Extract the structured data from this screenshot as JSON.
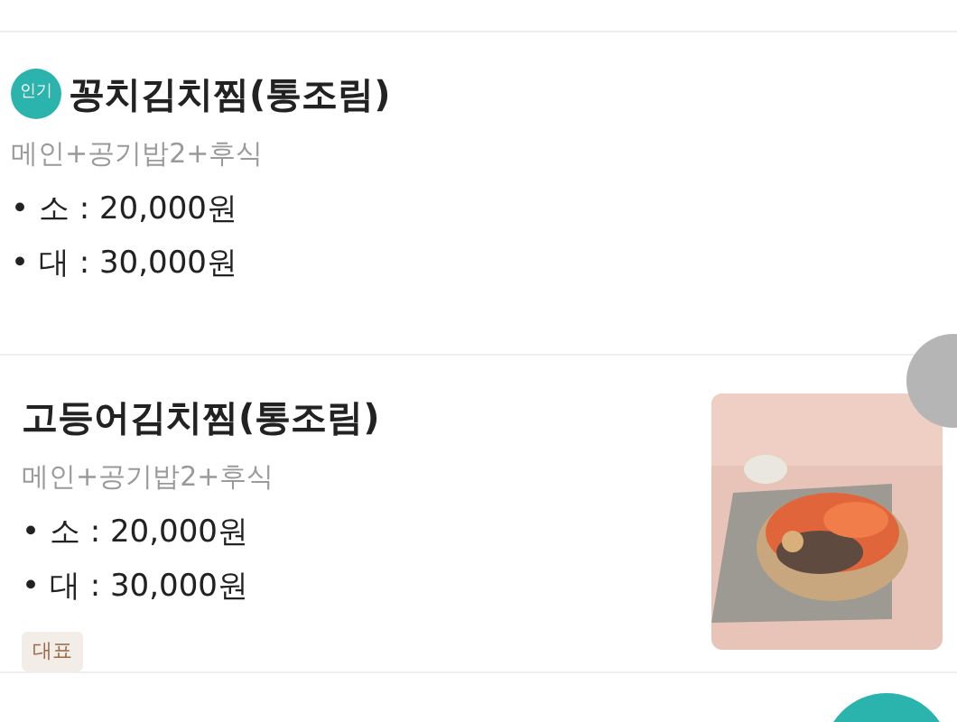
{
  "menu_items": [
    {
      "name": "꽁치김치찜(통조림)",
      "badge": "인기",
      "description": "메인+공기밥2+후식",
      "prices": [
        "• 소 : 20,000원",
        "• 대 : 30,000원"
      ]
    },
    {
      "name": "고등어김치찜(통조림)",
      "description": "메인+공기밥2+후식",
      "prices": [
        "• 소 : 20,000원",
        "• 대 : 30,000원"
      ],
      "tag": "대표"
    }
  ]
}
